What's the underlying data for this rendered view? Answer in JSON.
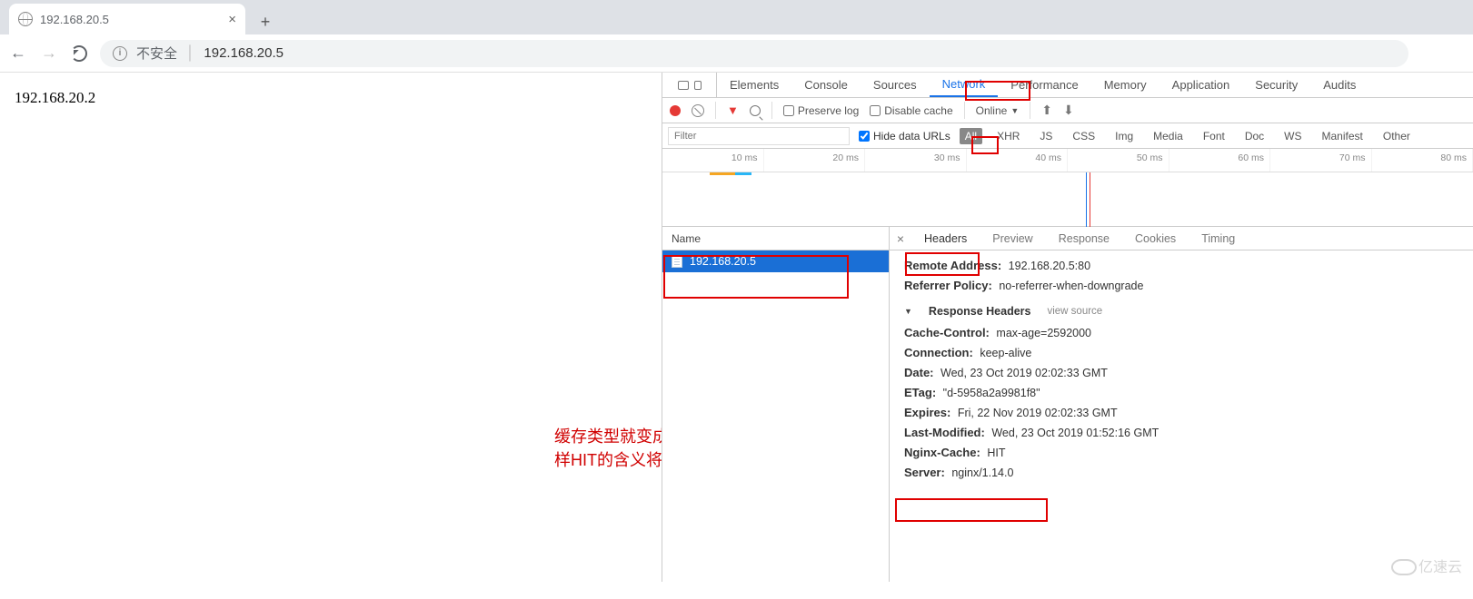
{
  "browser": {
    "tab_title": "192.168.20.5",
    "insecure_label": "不安全",
    "url": "192.168.20.5"
  },
  "page": {
    "body_text": "192.168.20.2"
  },
  "annotation": {
    "line1": "缓存类型就变成了HIT，同",
    "line2": "样HIT的含义将在下面解释"
  },
  "devtools": {
    "tabs": [
      "Elements",
      "Console",
      "Sources",
      "Network",
      "Performance",
      "Memory",
      "Application",
      "Security",
      "Audits"
    ],
    "active_tab": "Network",
    "toolbar": {
      "preserve_log": "Preserve log",
      "disable_cache": "Disable cache",
      "throttle": "Online"
    },
    "filter": {
      "placeholder": "Filter",
      "hide_data_urls": "Hide data URLs",
      "types": [
        "All",
        "XHR",
        "JS",
        "CSS",
        "Img",
        "Media",
        "Font",
        "Doc",
        "WS",
        "Manifest",
        "Other"
      ],
      "selected_type": "All"
    },
    "timeline_ticks": [
      "10 ms",
      "20 ms",
      "30 ms",
      "40 ms",
      "50 ms",
      "60 ms",
      "70 ms",
      "80 ms"
    ],
    "requests": {
      "column_name": "Name",
      "rows": [
        "192.168.20.5"
      ]
    },
    "detail_tabs": [
      "Headers",
      "Preview",
      "Response",
      "Cookies",
      "Timing"
    ],
    "active_detail_tab": "Headers",
    "general": {
      "remote_address": {
        "label": "Remote Address:",
        "value": "192.168.20.5:80"
      },
      "referrer_policy": {
        "label": "Referrer Policy:",
        "value": "no-referrer-when-downgrade"
      }
    },
    "response_headers_title": "Response Headers",
    "view_source": "view source",
    "response_headers": [
      {
        "k": "Cache-Control:",
        "v": "max-age=2592000"
      },
      {
        "k": "Connection:",
        "v": "keep-alive"
      },
      {
        "k": "Date:",
        "v": "Wed, 23 Oct 2019 02:02:33 GMT"
      },
      {
        "k": "ETag:",
        "v": "\"d-5958a2a9981f8\""
      },
      {
        "k": "Expires:",
        "v": "Fri, 22 Nov 2019 02:02:33 GMT"
      },
      {
        "k": "Last-Modified:",
        "v": "Wed, 23 Oct 2019 01:52:16 GMT"
      },
      {
        "k": "Nginx-Cache:",
        "v": "HIT"
      },
      {
        "k": "Server:",
        "v": "nginx/1.14.0"
      }
    ]
  },
  "watermark": "亿速云"
}
